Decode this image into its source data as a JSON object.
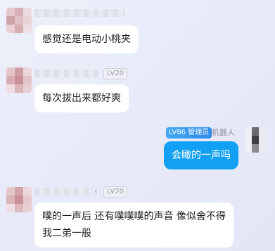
{
  "messages": [
    {
      "level": "",
      "text": "感觉还是电动小桃夹",
      "avatar_colors": [
        "#e6c9cd",
        "#d9b0b6",
        "#eddade",
        "#cfa3aa",
        "#dfc0c5",
        "#e9d2d6",
        "#eacfd3",
        "#d5adb3",
        "#f0e0e3"
      ]
    },
    {
      "level": "LV20",
      "text": "每次拔出来都好爽",
      "avatar_colors": [
        "#e3c4c9",
        "#cf9ea5",
        "#ebd6da",
        "#d7aeb4",
        "#c9929a",
        "#e2c5ca",
        "#efdde0",
        "#d9b6bb",
        "#e8cfd3"
      ]
    },
    {
      "admin_badge": "LV86 管理员",
      "role": "机器人",
      "text": "会瞰的一声吗",
      "avatar_colors": [
        "#eef0f5",
        "#6a6b70",
        "#e9ebf1",
        "#eef0f5",
        "#3f4045",
        "#e9ebf1",
        "#eef0f5",
        "#8a8b90",
        "#e9ebf1"
      ]
    },
    {
      "level": "LV20",
      "chevron": "‹",
      "line1": "噗的一声后 还有噗噗噗的声音  像似舍不得",
      "line2": "我二弟一般",
      "avatar_colors": [
        "#e4c6cb",
        "#d2a3aa",
        "#ecd7db",
        "#dab5ba",
        "#c99199",
        "#e5cace",
        "#f0dfe2",
        "#dcb9be",
        "#e9d0d4"
      ]
    }
  ]
}
